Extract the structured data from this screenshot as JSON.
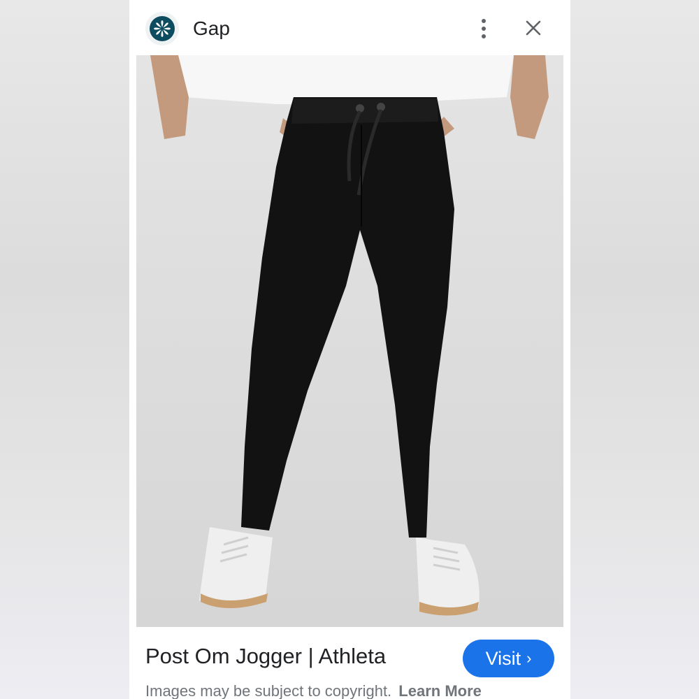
{
  "header": {
    "site_name": "Gap",
    "logo_icon": "pinwheel-logo-icon",
    "more_icon": "more-vert-icon",
    "close_icon": "close-icon"
  },
  "image": {
    "description_icon": "product-photo",
    "subject": "black jogger pants with white sneakers"
  },
  "result": {
    "title": "Post Om Jogger | Athleta",
    "visit_label": "Visit",
    "visit_chevron": "›"
  },
  "footer": {
    "copyright_text": "Images may be subject to copyright.",
    "learn_more": "Learn More"
  },
  "colors": {
    "accent": "#1a73e8",
    "logo": "#0d4b5f",
    "text": "#202124",
    "muted": "#70757a"
  }
}
